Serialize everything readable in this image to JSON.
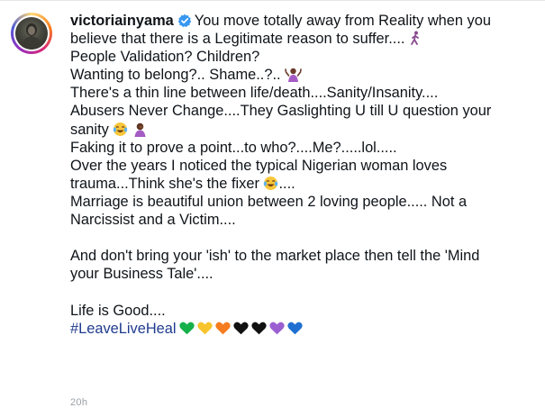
{
  "post": {
    "username": "victoriainyama",
    "verified": true,
    "lines": [
      "You move totally away from Reality when you",
      "believe that there is a Legitimate reason to suffer....",
      "People Validation? Children?",
      "Wanting to belong?.. Shame..?..",
      "There's a thin line between life/death....Sanity/Insanity....",
      "Abusers Never Change....They Gaslighting U till U question your",
      "sanity",
      "Faking it to prove a point...to who?....Me?.....lol.....",
      "Over the years I noticed the typical Nigerian woman loves",
      "trauma...Think she's the fixer",
      "....",
      "Marriage is beautiful union between 2 loving people..... Not a",
      "Narcissist and a Victim....",
      "",
      "And don't bring your 'ish' to the market place then tell the 'Mind",
      "your Business Tale'....",
      "",
      "Life is Good...."
    ],
    "hashtag": "#LeaveLiveHeal",
    "emojis": {
      "line2": "person-walking-emoji",
      "line4": "person-shrugging-emoji",
      "line7a": "face-with-tears-of-joy-emoji",
      "line7b": "person-facepalming-emoji",
      "line10": "face-with-tears-of-joy-emoji"
    },
    "hearts": [
      {
        "name": "green-heart-icon",
        "color": "#15b04a"
      },
      {
        "name": "yellow-heart-icon",
        "color": "#f7c52b"
      },
      {
        "name": "orange-heart-icon",
        "color": "#f57c1f"
      },
      {
        "name": "black-heart-icon",
        "color": "#111111"
      },
      {
        "name": "black-heart-icon",
        "color": "#111111"
      },
      {
        "name": "purple-heart-icon",
        "color": "#9b5fd1"
      },
      {
        "name": "blue-heart-icon",
        "color": "#1f6fd1"
      }
    ],
    "timestamp": "20h"
  },
  "colors": {
    "text": "#0f1419",
    "hashtag": "#1f3b8f",
    "verified": "#3897f0"
  }
}
